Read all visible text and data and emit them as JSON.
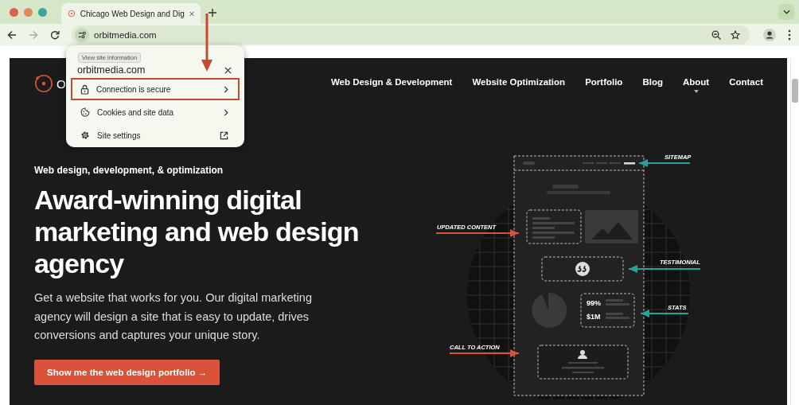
{
  "browser": {
    "tab": {
      "title": "Chicago Web Design and Dig",
      "selected": true
    },
    "address": "orbitmedia.com",
    "forward_disabled": true
  },
  "site_info_popup": {
    "tooltip": "View site information",
    "title": "orbitmedia.com",
    "items": [
      {
        "label": "Connection is secure",
        "kind": "submenu",
        "highlighted": true
      },
      {
        "label": "Cookies and site data",
        "kind": "submenu",
        "highlighted": false
      },
      {
        "label": "Site settings",
        "kind": "external",
        "highlighted": false
      }
    ]
  },
  "site": {
    "logo_text": "O",
    "nav": [
      {
        "label": "Web Design & Development",
        "dropdown": false
      },
      {
        "label": "Website Optimization",
        "dropdown": false
      },
      {
        "label": "Portfolio",
        "dropdown": false
      },
      {
        "label": "Blog",
        "dropdown": false
      },
      {
        "label": "About",
        "dropdown": true
      },
      {
        "label": "Contact",
        "dropdown": false
      }
    ],
    "hero": {
      "eyebrow": "Web design, development, & optimization",
      "heading": "Award-winning digital marketing and web design agency",
      "text": "Get a website that works for you. Our digital marketing agency will design a site that is easy to update, drives conversions and captures your unique story.",
      "button": "Show me the web design portfolio →"
    },
    "illustration": {
      "callouts": [
        {
          "label": "SITEMAP",
          "color": "#2aa19a"
        },
        {
          "label": "UPDATED CONTENT",
          "color": "#d9533a"
        },
        {
          "label": "TESTIMONIAL",
          "color": "#2aa19a"
        },
        {
          "label": "STATS",
          "color": "#2aa19a"
        },
        {
          "label": "CALL TO ACTION",
          "color": "#d9533a"
        }
      ],
      "stats": [
        "99%",
        "$1M"
      ]
    }
  }
}
